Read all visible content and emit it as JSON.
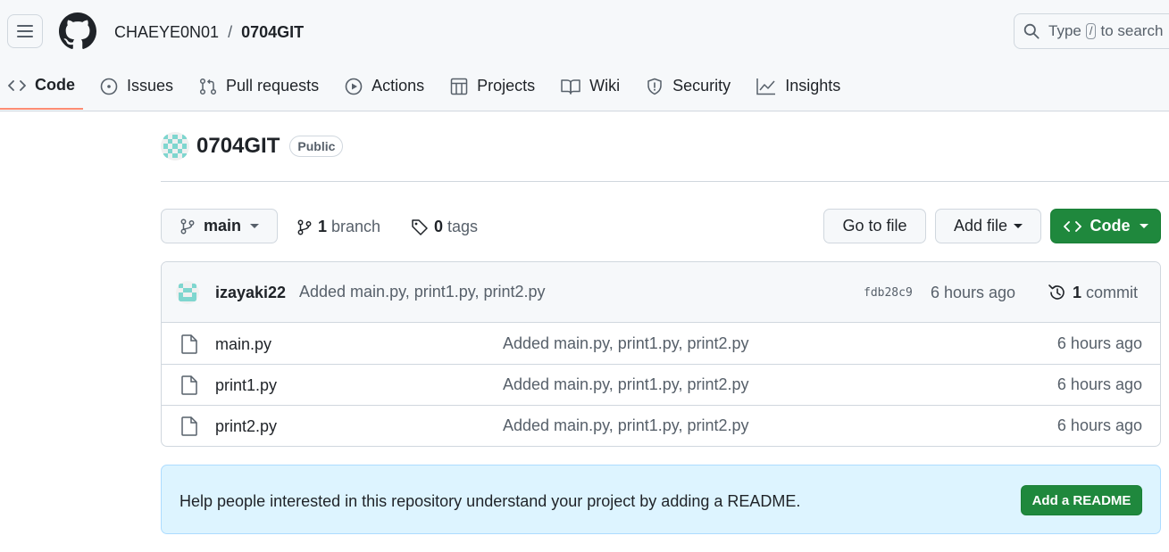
{
  "header": {
    "owner": "CHAEYE0N01",
    "separator": "/",
    "repo": "0704GIT",
    "search_prefix": "Type",
    "search_key": "/",
    "search_suffix": "to search"
  },
  "nav": {
    "tabs": [
      {
        "label": "Code",
        "icon": "code-icon",
        "active": true
      },
      {
        "label": "Issues",
        "icon": "issue-icon"
      },
      {
        "label": "Pull requests",
        "icon": "pull-request-icon"
      },
      {
        "label": "Actions",
        "icon": "play-icon"
      },
      {
        "label": "Projects",
        "icon": "table-icon"
      },
      {
        "label": "Wiki",
        "icon": "book-icon"
      },
      {
        "label": "Security",
        "icon": "shield-icon"
      },
      {
        "label": "Insights",
        "icon": "graph-icon"
      }
    ]
  },
  "repo": {
    "name": "0704GIT",
    "visibility": "Public"
  },
  "toolbar": {
    "branch": "main",
    "branch_count": "1",
    "branch_label": "branch",
    "tag_count": "0",
    "tag_label": "tags",
    "go_to_file": "Go to file",
    "add_file": "Add file",
    "code": "Code"
  },
  "latest_commit": {
    "author": "izayaki22",
    "message": "Added main.py, print1.py, print2.py",
    "hash": "fdb28c9",
    "time": "6 hours ago",
    "count": "1",
    "count_label": "commit"
  },
  "files": [
    {
      "name": "main.py",
      "message": "Added main.py, print1.py, print2.py",
      "time": "6 hours ago"
    },
    {
      "name": "print1.py",
      "message": "Added main.py, print1.py, print2.py",
      "time": "6 hours ago"
    },
    {
      "name": "print2.py",
      "message": "Added main.py, print1.py, print2.py",
      "time": "6 hours ago"
    }
  ],
  "readme_banner": {
    "text": "Help people interested in this repository understand your project by adding a README.",
    "button": "Add a README"
  },
  "colors": {
    "primary_green": "#1f883d",
    "active_tab_underline": "#fd8c73",
    "banner_bg": "#ddf4ff",
    "avatar_teal": "#7fd6cf"
  }
}
